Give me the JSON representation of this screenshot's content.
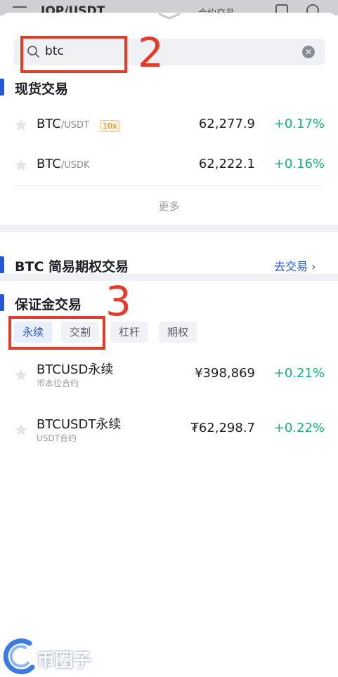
{
  "topbar": {
    "pair": "IOP/USDT",
    "mode": "合约交易"
  },
  "search": {
    "value": "btc",
    "clear_icon": "clear-icon",
    "search_icon": "search-icon"
  },
  "annotations": {
    "search_number": "2",
    "tabs_number": "3",
    "color": "#e63a2a"
  },
  "spot": {
    "title": "现货交易",
    "rows": [
      {
        "base": "BTC",
        "quote": "/USDT",
        "leverage": "10x",
        "price": "62,277.9",
        "change": "+0.17%"
      },
      {
        "base": "BTC",
        "quote": "/USDK",
        "leverage": "",
        "price": "62,222.1",
        "change": "+0.16%"
      }
    ],
    "more": "更多"
  },
  "options": {
    "title": "BTC 简易期权交易",
    "go_trade": "去交易 ›"
  },
  "margin": {
    "title": "保证金交易",
    "tabs": [
      "永续",
      "交割",
      "杠杆",
      "期权"
    ],
    "active_tab": "永续",
    "rows": [
      {
        "name": "BTCUSD永续",
        "sub": "币本位合约",
        "price": "¥398,869",
        "change": "+0.21%"
      },
      {
        "name": "BTCUSDT永续",
        "sub": "USDT合约",
        "price": "₮62,298.7",
        "change": "+0.22%"
      }
    ]
  },
  "watermark": {
    "text": "币圈子"
  },
  "colors": {
    "accent": "#2457d6",
    "up": "#14b27c",
    "annotation": "#e63a2a"
  }
}
